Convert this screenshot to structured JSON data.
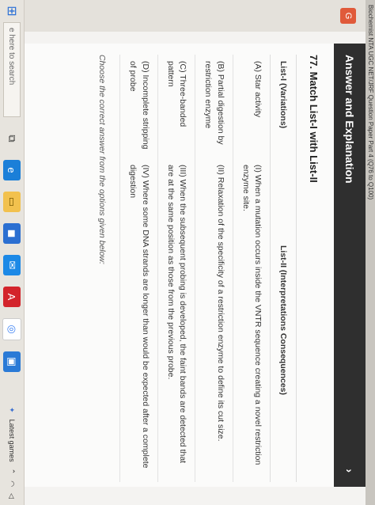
{
  "browser": {
    "tab_title": "Biochemist NTA UGC NET/JRF Question Paper Part 4 (Q76 to Q100)"
  },
  "gutter": {
    "badge": "G"
  },
  "answer": {
    "header": "Answer and Explanation",
    "chevron": "›"
  },
  "question": {
    "title": "77. Match List-I with List-II",
    "headers": [
      "List-I (Variations)",
      "List-II (Interpretations Consequences)"
    ],
    "rows": [
      [
        "(A) Star activity",
        "(I) When a mutation occurs inside the VNTR sequence creating a novel restriction enzyme site."
      ],
      [
        "(B) Partial digestion by restriction enzyme",
        "(II) Relaxation of the specificity of a restriction enzyme to define its cut size."
      ],
      [
        "(C) Three-banded pattern",
        "(III) When the subsequent probing is developed, the faint bands are detected that are at the same position as those from the previous probe."
      ],
      [
        "(D) Incomplete stripping of probe",
        "(IV) Where some DNA strands are longer than would be expected after a complete digestion"
      ]
    ],
    "instruction": "Choose the correct answer from the options given below:"
  },
  "taskbar": {
    "search_placeholder": "e here to search",
    "tray_label": "Latest games",
    "icons": [
      "task-view-icon",
      "edge-icon",
      "file-explorer-icon",
      "store-icon",
      "mail-icon",
      "acrobat-icon",
      "chrome-icon",
      "photos-icon"
    ]
  },
  "colors": {
    "header_bg": "#2f2f2f",
    "badge": "#e05a3a",
    "accent": "#2a6fd6"
  }
}
